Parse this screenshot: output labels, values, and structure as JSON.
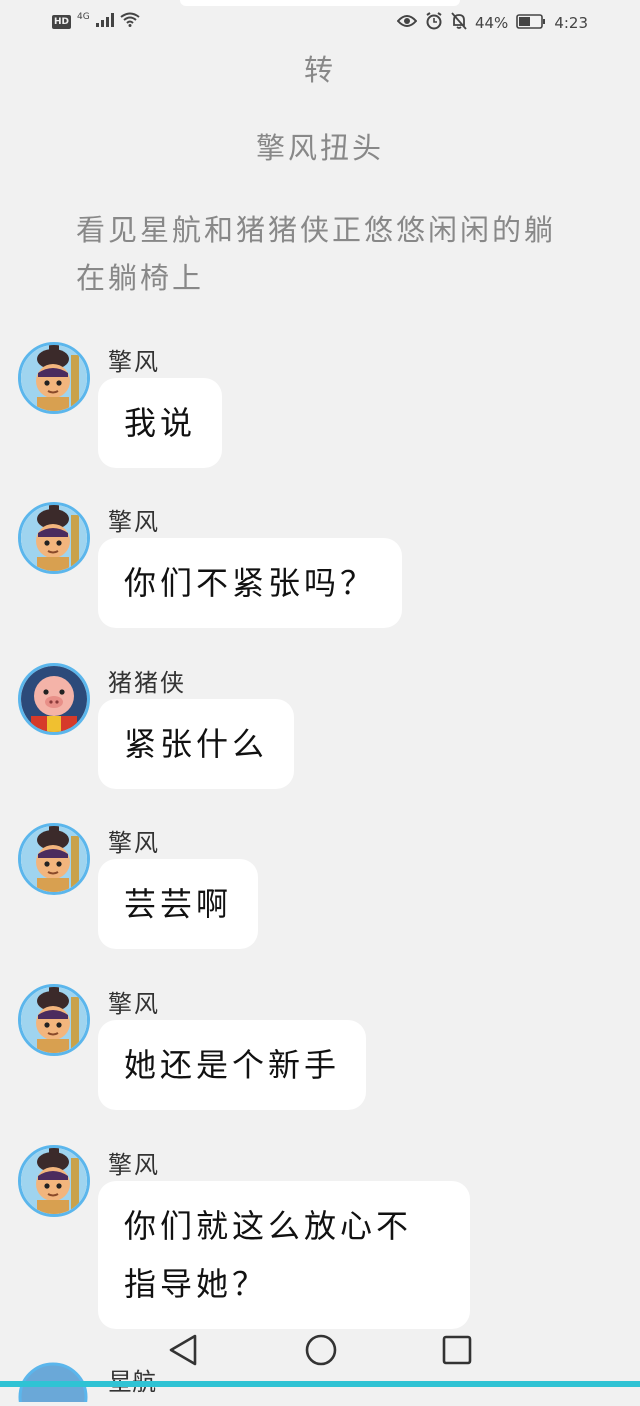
{
  "status_bar": {
    "hd": "HD",
    "network": "4G",
    "battery_percent": "44%",
    "time": "4:23"
  },
  "narration": [
    "转",
    "擎风扭头",
    "看见星航和猪猪侠正悠悠闲闲的躺在躺椅上"
  ],
  "messages": [
    {
      "sender": "擎风",
      "text": "我说"
    },
    {
      "sender": "擎风",
      "text": "你们不紧张吗？"
    },
    {
      "sender": "猪猪侠",
      "text": "紧张什么"
    },
    {
      "sender": "擎风",
      "text": "芸芸啊"
    },
    {
      "sender": "擎风",
      "text": "她还是个新手"
    },
    {
      "sender": "擎风",
      "text": "你们就这么放心不指导她？"
    }
  ],
  "bottom_peek": {
    "sender": "星航"
  },
  "colors": {
    "background": "#f1f1f1",
    "bubble": "#ffffff",
    "avatar_border": "#5bb6ec",
    "accent_line": "#2fc3d4"
  }
}
